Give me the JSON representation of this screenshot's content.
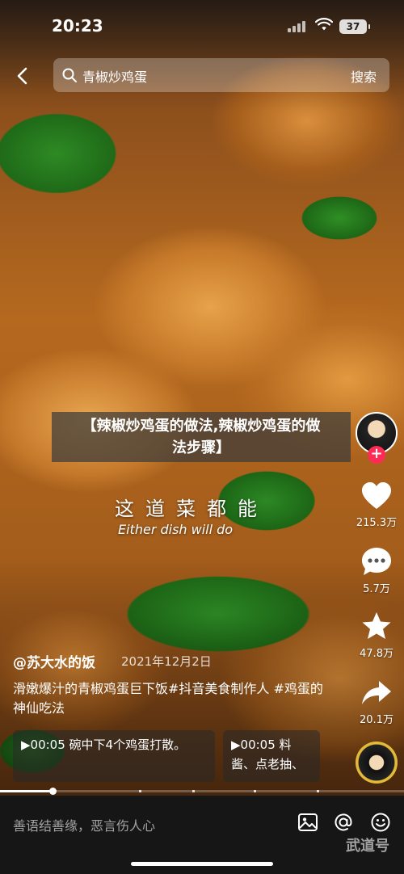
{
  "status_bar": {
    "time": "20:23",
    "battery": "37"
  },
  "search": {
    "query": "青椒炒鸡蛋",
    "button": "搜索"
  },
  "video": {
    "title_lines": [
      "【辣椒炒鸡蛋的做法,辣椒炒鸡蛋的做",
      "法步骤】"
    ],
    "overlay_zh": "这道菜都能",
    "overlay_en": "Either dish will do"
  },
  "rail": {
    "likes": "215.3万",
    "comments": "5.7万",
    "favorites": "47.8万",
    "shares": "20.1万",
    "follow": "+"
  },
  "info": {
    "author": "@苏大水的饭",
    "date": "2021年12月2日",
    "description": "滑嫩爆汁的青椒鸡蛋巨下饭#抖音美食制作人 #鸡蛋的神仙吃法"
  },
  "chapters": [
    {
      "label": "▶00:05 碗中下4个鸡蛋打散。"
    },
    {
      "label": "▶00:05 料酱、点老抽、"
    }
  ],
  "progress": {
    "played": 0.13
  },
  "comment_bar": {
    "placeholder": "善语结善缘，恶言伤人心",
    "watermark": "武道号"
  }
}
